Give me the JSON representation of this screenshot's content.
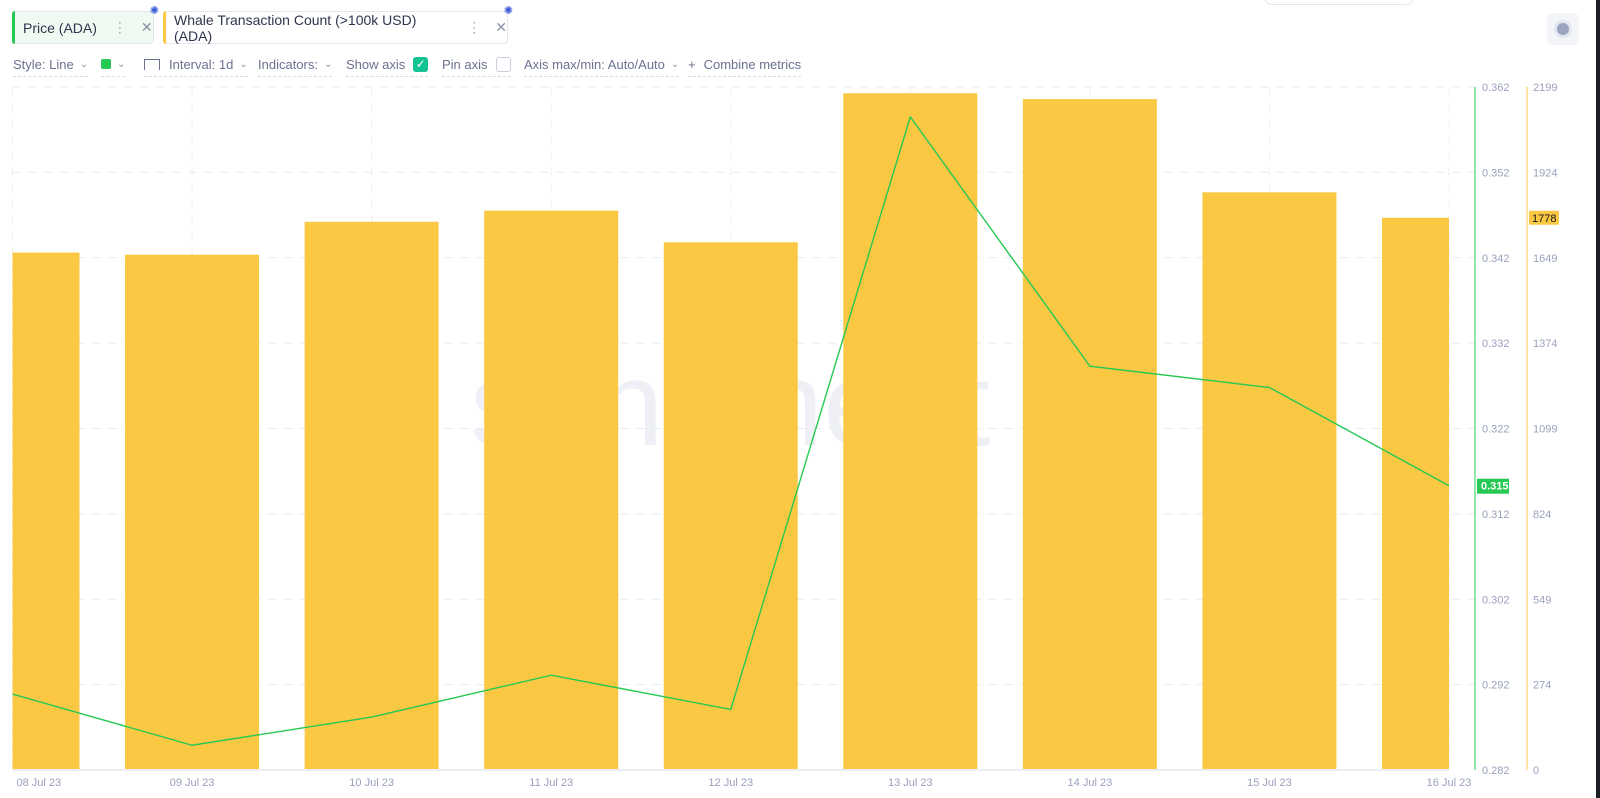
{
  "tabs": [
    {
      "label": "Price (ADA)",
      "color": "#26c953"
    },
    {
      "label": "Whale Transaction Count (>100k USD) (ADA)",
      "color": "#fbc844"
    }
  ],
  "toolbar": {
    "style": "Style: Line",
    "interval": "Interval: 1d",
    "indicators": "Indicators:",
    "show_axis": "Show axis",
    "show_axis_checked": true,
    "pin_axis": "Pin axis",
    "pin_axis_checked": false,
    "axis_maxmin": "Axis max/min: Auto/Auto",
    "combine": "Combine metrics",
    "plus": "+",
    "check": "✓",
    "chevron": "⌄"
  },
  "watermark": "santiment",
  "chart_data": {
    "type": "bar+line",
    "categories": [
      "08 Jul 23",
      "09 Jul 23",
      "10 Jul 23",
      "11 Jul 23",
      "12 Jul 23",
      "13 Jul 23",
      "14 Jul 23",
      "15 Jul 23",
      "16 Jul 23"
    ],
    "series": [
      {
        "name": "Whale Transaction Count (>100k USD) (ADA)",
        "type": "bar",
        "axis": "right",
        "color": "#fbc844",
        "values": [
          1666,
          1659,
          1765,
          1801,
          1699,
          2179,
          2160,
          1860,
          1778
        ]
      },
      {
        "name": "Price (ADA)",
        "type": "line",
        "axis": "left",
        "color": "#26c953",
        "values": [
          0.2909,
          0.2849,
          0.2882,
          0.2931,
          0.2891,
          0.3585,
          0.3293,
          0.3268,
          0.3153
        ]
      }
    ],
    "price_axis": {
      "ticks": [
        "0.362",
        "0.352",
        "0.342",
        "0.332",
        "0.322",
        "0.312",
        "0.302",
        "0.292",
        "0.282"
      ],
      "range": [
        0.282,
        0.362
      ]
    },
    "count_axis": {
      "ticks": [
        "2199",
        "1924",
        "1649",
        "1374",
        "1099",
        "824",
        "549",
        "274",
        "0"
      ],
      "range": [
        0,
        2199
      ]
    },
    "last_price_label": "0.315",
    "last_count_label": "1778"
  }
}
